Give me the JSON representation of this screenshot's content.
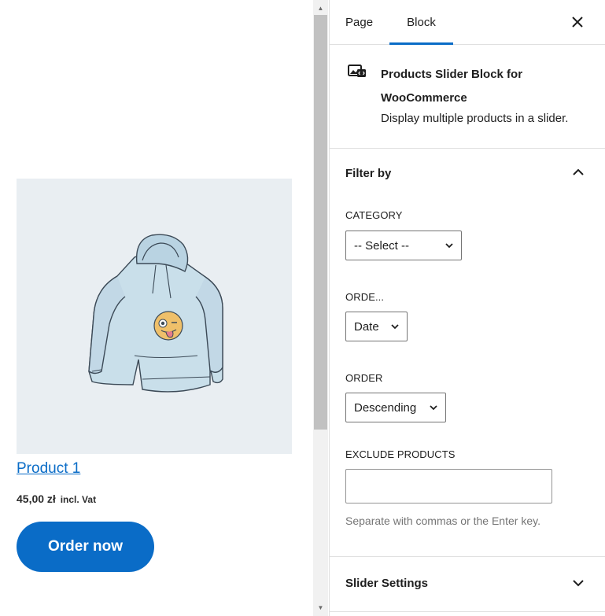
{
  "canvas": {
    "product": {
      "title": "Product 1",
      "price": "45,00 zł",
      "vat": "incl. Vat",
      "button_label": "Order now"
    }
  },
  "sidebar": {
    "tabs": [
      {
        "label": "Page",
        "active": false
      },
      {
        "label": "Block",
        "active": true
      }
    ],
    "close_icon": "close-icon",
    "block": {
      "icon": "block-icon",
      "title": "Products Slider Block for WooCommerce",
      "description": "Display multiple products in a slider."
    },
    "filter_panel": {
      "title": "Filter by",
      "expanded": true,
      "category": {
        "label": "CATEGORY",
        "value": "-- Select --"
      },
      "order_by": {
        "label": "ORDE...",
        "value": "Date"
      },
      "order": {
        "label": "ORDER",
        "value": "Descending"
      },
      "exclude": {
        "label": "EXCLUDE PRODUCTS",
        "value": "",
        "help": "Separate with commas or the Enter key."
      }
    },
    "slider_panel": {
      "title": "Slider Settings",
      "expanded": false
    }
  },
  "colors": {
    "accent": "#0a6cc7",
    "image_bg": "#e9eef2",
    "border": "#e0e0e0",
    "help_text": "#757575"
  }
}
